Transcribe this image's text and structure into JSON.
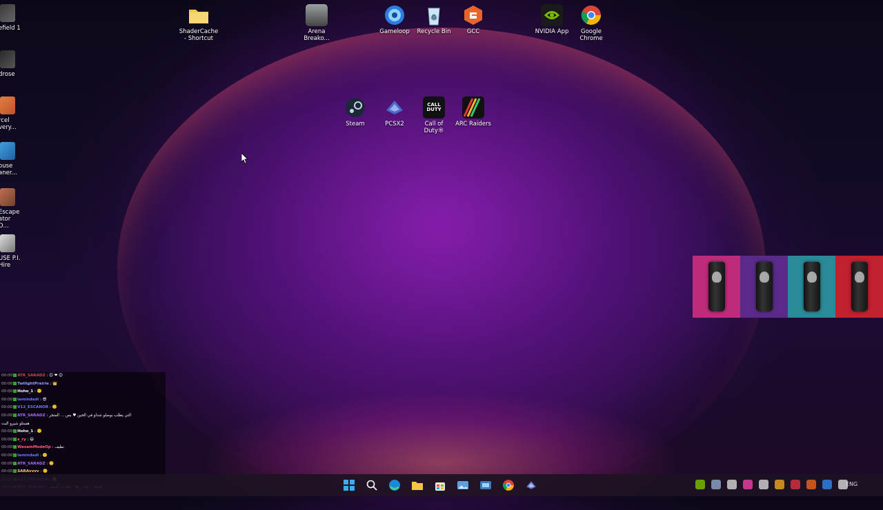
{
  "desktop": {
    "icons": [
      {
        "id": "shadercache",
        "label": "ShaderCache\n- Shortcut",
        "icon": "folder-icon"
      },
      {
        "id": "arena",
        "label": "Arena\nBreako...",
        "icon": "arena-breakout-icon"
      },
      {
        "id": "gameloop",
        "label": "Gameloop",
        "icon": "gameloop-icon"
      },
      {
        "id": "recycle",
        "label": "Recycle Bin",
        "icon": "recycle-bin-icon"
      },
      {
        "id": "gcc",
        "label": "GCC",
        "icon": "gcc-icon"
      },
      {
        "id": "nvidia",
        "label": "NVIDIA App",
        "icon": "nvidia-icon"
      },
      {
        "id": "chrome",
        "label": "Google\nChrome",
        "icon": "chrome-icon"
      },
      {
        "id": "steam",
        "label": "Steam",
        "icon": "steam-icon"
      },
      {
        "id": "pcsx2",
        "label": "PCSX2",
        "icon": "pcsx2-icon"
      },
      {
        "id": "cod",
        "label": "Call of\nDuty®",
        "icon": "call-of-duty-icon"
      },
      {
        "id": "arc",
        "label": "ARC Raiders",
        "icon": "arc-raiders-icon"
      }
    ],
    "left_icons": [
      {
        "label": "efield 1"
      },
      {
        "label": "drose"
      },
      {
        "label": "rcel\nvery..."
      },
      {
        "label": "ouse\naner..."
      },
      {
        "label": "Escape\nator D..."
      },
      {
        "label": "USE P.I.\nHire"
      }
    ]
  },
  "ad_panel": {
    "cans": [
      {
        "color": "#c02a7a"
      },
      {
        "color": "#5a2a8a"
      },
      {
        "color": "#2a8a9a"
      },
      {
        "color": "#c02030"
      }
    ]
  },
  "chat": {
    "rows": [
      {
        "ts": "00:00",
        "user": "ATR_SARADZ",
        "user_color": "#c05050",
        "msg": ": 😊 ❤ 😊"
      },
      {
        "ts": "00:00",
        "user": "TwilightPrairie",
        "user_color": "#9aa0ff",
        "msg": ": 👑"
      },
      {
        "ts": "00:00",
        "user": "Hoho_1",
        "user_color": "#ffffff",
        "msg": ": 🙂"
      },
      {
        "ts": "00:00",
        "user": "lamindadi",
        "user_color": "#6a7bff",
        "msg": ": 😎"
      },
      {
        "ts": "00:00",
        "user": "V12_ESCANOR",
        "user_color": "#6a7bff",
        "msg": ": 🙂"
      },
      {
        "ts": "00:00",
        "user": "ATR_SARADZ",
        "user_color": "#a070ff",
        "msg": ": التي يطلب بوصلو شداو في الحين ♥ بس ...  المتجر"
      },
      {
        "ts": "",
        "user": "",
        "user_color": "#ffffff",
        "msg": "هستلو شيرو البث"
      },
      {
        "ts": "00:00",
        "user": "Hoho_1",
        "user_color": "#ffffff",
        "msg": ": 🙂"
      },
      {
        "ts": "00:00",
        "user": "s_ry",
        "user_color": "#ff7070",
        "msg": ": 😄"
      },
      {
        "ts": "00:00",
        "user": "WesamModeOp",
        "user_color": "#ff6080",
        "msg": ": نظيف"
      },
      {
        "ts": "00:00",
        "user": "lamindadi",
        "user_color": "#6a7bff",
        "msg": ": 🙂"
      },
      {
        "ts": "00:00",
        "user": "ATR_SARADZ",
        "user_color": "#a070ff",
        "msg": ": 🙂"
      },
      {
        "ts": "00:00",
        "user": "SARAvvvv",
        "user_color": "#ffd080",
        "msg": ": 🙂"
      },
      {
        "ts": "00:00",
        "user": "V12_ESCANOR",
        "user_color": "#6a7bff",
        "msg": ": 🙂"
      },
      {
        "ts": "00:00",
        "user": "ATR_SARADZ",
        "user_color": "#a070ff",
        "msg": ": المتجر | كلاب 👆 | تكحول المتجر"
      }
    ]
  },
  "taskbar": {
    "apps": [
      {
        "id": "start",
        "icon": "windows-start-icon",
        "color": "#3fa9f5"
      },
      {
        "id": "search",
        "icon": "search-icon",
        "color": "#ffffff"
      },
      {
        "id": "edge",
        "icon": "edge-icon",
        "color": "#2bb0a0"
      },
      {
        "id": "explorer",
        "icon": "file-explorer-icon",
        "color": "#f4c542"
      },
      {
        "id": "store",
        "icon": "store-icon",
        "color": "#4a90d9"
      },
      {
        "id": "photos",
        "icon": "photos-icon",
        "color": "#5aa0e0"
      },
      {
        "id": "snipping",
        "icon": "snipping-icon",
        "color": "#5ab0e0"
      },
      {
        "id": "chrome",
        "icon": "chrome-icon",
        "color": "#e0a020"
      },
      {
        "id": "pcsx2",
        "icon": "pcsx2-icon",
        "color": "#7080c0"
      }
    ],
    "tray": [
      {
        "icon": "nvidia-tray-icon",
        "color": "#76b900"
      },
      {
        "icon": "steam-tray-icon",
        "color": "#8aa0c0"
      },
      {
        "icon": "battery-tray-icon",
        "color": "#cccccc"
      },
      {
        "icon": "app-tray-icon",
        "color": "#e040a0"
      },
      {
        "icon": "arrow-tray-icon",
        "color": "#cccccc"
      },
      {
        "icon": "chrome-tray-icon",
        "color": "#e0a020"
      },
      {
        "icon": "amd-tray-icon",
        "color": "#d03040"
      },
      {
        "icon": "gcc-tray-icon",
        "color": "#e06020"
      },
      {
        "icon": "bluetooth-tray-icon",
        "color": "#3080e0"
      },
      {
        "icon": "network-tray-icon",
        "color": "#cccccc"
      }
    ],
    "language": "ENG"
  }
}
